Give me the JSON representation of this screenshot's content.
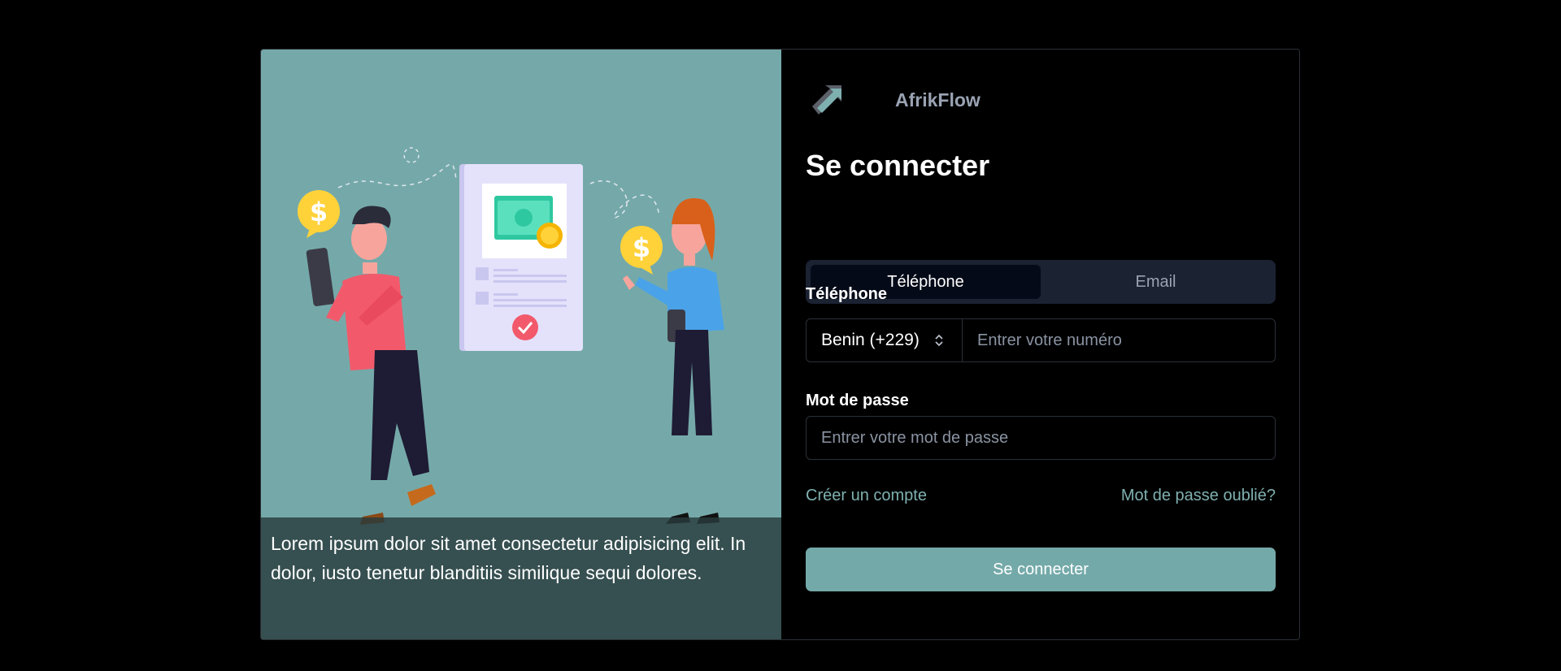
{
  "illustration": {
    "caption": "Lorem ipsum dolor sit amet consectetur adipisicing elit. In dolor, iusto tenetur blanditiis similique sequi dolores."
  },
  "brand": {
    "name": "AfrikFlow",
    "logo_icon": "afrikflow-logo-icon"
  },
  "login": {
    "title": "Se connecter",
    "tabs": [
      {
        "label": "Téléphone",
        "active": true
      },
      {
        "label": "Email",
        "active": false
      }
    ],
    "phone_label": "Téléphone",
    "country_selected": "Benin (+229)",
    "phone_placeholder": "Entrer votre numéro",
    "password_label": "Mot de passe",
    "password_placeholder": "Entrer votre mot de passe",
    "create_account": "Créer un compte",
    "forgot_password": "Mot de passe oublié?",
    "submit_label": "Se connecter"
  },
  "colors": {
    "accent": "#74a9a9",
    "illustration_bg": "#75a9a9",
    "tab_track": "#1b2232",
    "tab_active": "#050a18"
  }
}
